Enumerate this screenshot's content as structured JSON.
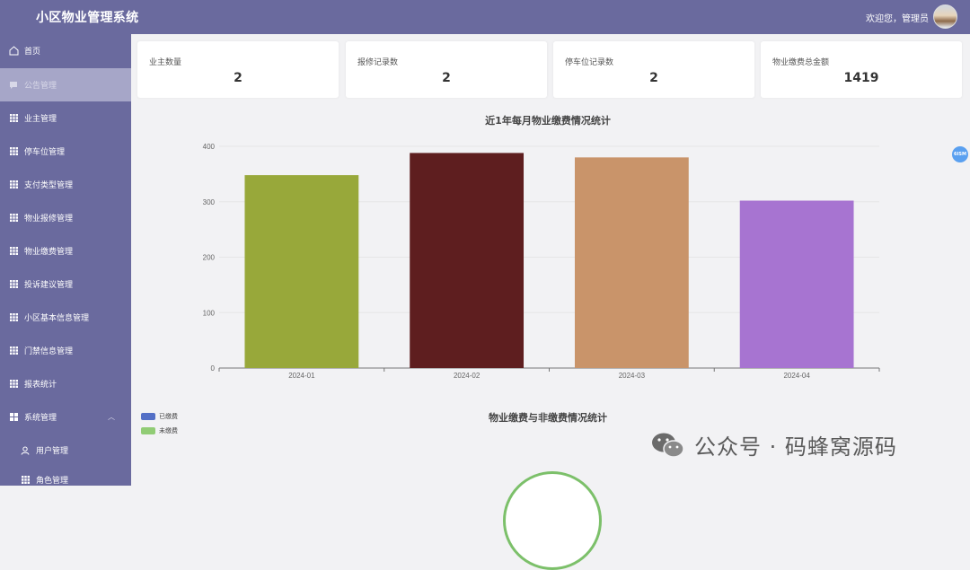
{
  "header": {
    "title": "小区物业管理系统",
    "welcome": "欢迎您，管理员"
  },
  "sidebar": {
    "items": [
      {
        "label": "首页",
        "icon": "home-icon"
      },
      {
        "label": "公告管理",
        "icon": "message-icon",
        "active": true
      },
      {
        "label": "业主管理",
        "icon": "grid-icon"
      },
      {
        "label": "停车位管理",
        "icon": "grid-icon"
      },
      {
        "label": "支付类型管理",
        "icon": "grid-icon"
      },
      {
        "label": "物业报修管理",
        "icon": "grid-icon"
      },
      {
        "label": "物业缴费管理",
        "icon": "grid-icon"
      },
      {
        "label": "投诉建议管理",
        "icon": "grid-icon"
      },
      {
        "label": "小区基本信息管理",
        "icon": "grid-icon"
      },
      {
        "label": "门禁信息管理",
        "icon": "grid-icon"
      },
      {
        "label": "报表统计",
        "icon": "grid-icon"
      },
      {
        "label": "系统管理",
        "icon": "apps-icon",
        "expandable": true
      },
      {
        "label": "用户管理",
        "icon": "user-icon",
        "sub": true
      },
      {
        "label": "角色管理",
        "icon": "grid-icon",
        "sub": true
      }
    ]
  },
  "stats": [
    {
      "label": "业主数量",
      "value": "2"
    },
    {
      "label": "报修记录数",
      "value": "2"
    },
    {
      "label": "停车位记录数",
      "value": "2"
    },
    {
      "label": "物业缴费总金额",
      "value": "1419"
    }
  ],
  "badge": "6ISM",
  "chart_data": [
    {
      "type": "bar",
      "title": "近1年每月物业缴费情况统计",
      "categories": [
        "2024-01",
        "2024-02",
        "2024-03",
        "2024-04"
      ],
      "values": [
        348,
        388,
        380,
        302
      ],
      "colors": [
        "#98a83a",
        "#5e1e1f",
        "#c9946a",
        "#a774d1"
      ],
      "ylim": [
        0,
        400
      ],
      "yticks": [
        0,
        100,
        200,
        300,
        400
      ],
      "grid": true
    },
    {
      "type": "pie",
      "title": "物业缴费与非缴费情况统计",
      "legend_position": "top-left",
      "series": [
        {
          "name": "已缴费",
          "color": "#5470c6"
        },
        {
          "name": "未缴费",
          "color": "#91cc75"
        }
      ]
    }
  ],
  "watermark": "公众号 · 码蜂窝源码"
}
